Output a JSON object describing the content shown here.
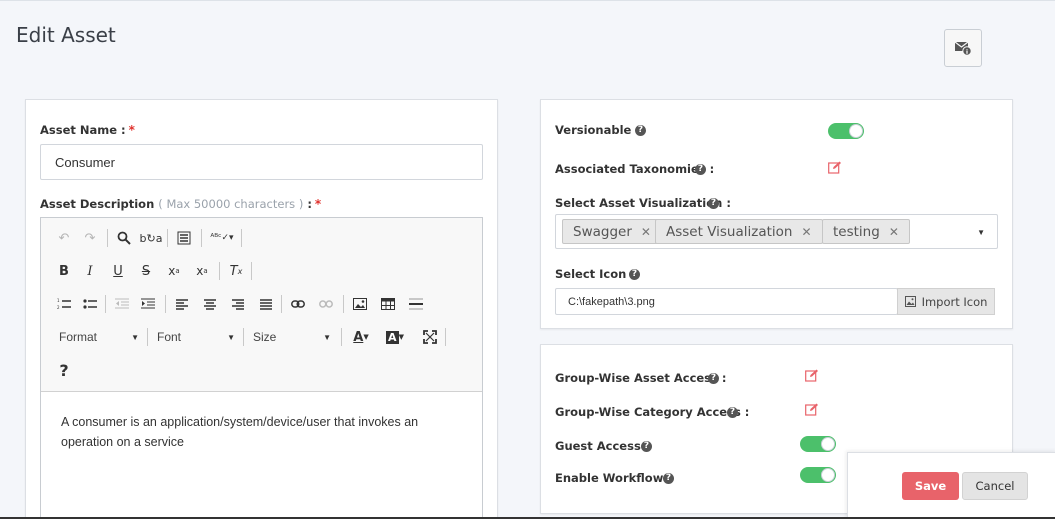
{
  "page": {
    "title": "Edit Asset"
  },
  "icons": {
    "mail": "mail-info-icon",
    "edit": "edit-icon",
    "help": "help-circle-icon",
    "image": "image-icon"
  },
  "colors": {
    "toggle_on": "#4cc06b",
    "edit_icon": "#e8636a",
    "save_button": "#e8636a",
    "required": "#e0322d"
  },
  "asset": {
    "name_label": "Asset Name :",
    "required_mark": "*",
    "name_value": "Consumer",
    "description_label": "Asset Description",
    "description_hint": "( Max 50000 characters )",
    "description_colon": " :",
    "description_text": "A consumer is an application/system/device/user that invokes an operation on a service"
  },
  "editor": {
    "format_label": "Format",
    "font_label": "Font",
    "size_label": "Size",
    "help_label": "?"
  },
  "settings": {
    "versionable_label": "Versionable :",
    "versionable_on": true,
    "taxonomies_label": "Associated Taxonomies :",
    "visualization_label": "Select Asset Visualization :",
    "visualization_tags": [
      "Swagger",
      "Asset Visualization",
      "testing"
    ],
    "icon_label": "Select Icon :",
    "icon_value": "C:\\fakepath\\3.png",
    "import_label": "Import Icon"
  },
  "access": {
    "group_asset_label": "Group-Wise Asset Access :",
    "group_category_label": "Group-Wise Category Access :",
    "guest_label": "Guest Access :",
    "guest_on": true,
    "workflow_label": "Enable Workflow :",
    "workflow_on": true
  },
  "actions": {
    "save_label": "Save",
    "cancel_label": "Cancel"
  }
}
